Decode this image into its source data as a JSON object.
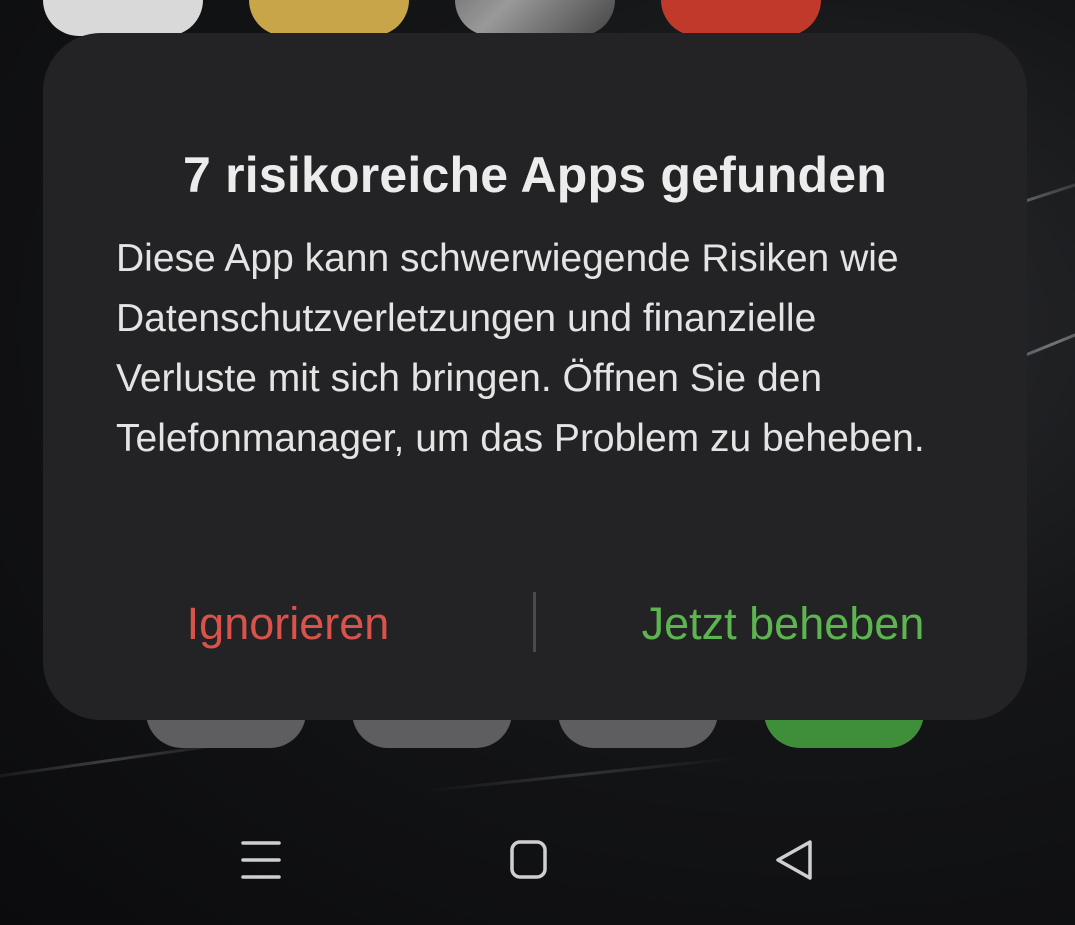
{
  "dialog": {
    "title": "7 risikoreiche Apps gefunden",
    "message": "Diese App kann schwerwiegende Risiken wie Datenschutzverletzungen und finanzielle Verluste mit sich bringen. Öffnen Sie den Telefonmanager, um das Problem zu beheben.",
    "ignore_label": "Ignorieren",
    "fix_label": "Jetzt beheben"
  },
  "navbar": {
    "icons": [
      "menu-icon",
      "home-icon",
      "back-icon"
    ]
  },
  "colors": {
    "dialog_background": "#232325",
    "ignore": "#d9534a",
    "fix": "#5cb54f",
    "text": "#ececec"
  }
}
